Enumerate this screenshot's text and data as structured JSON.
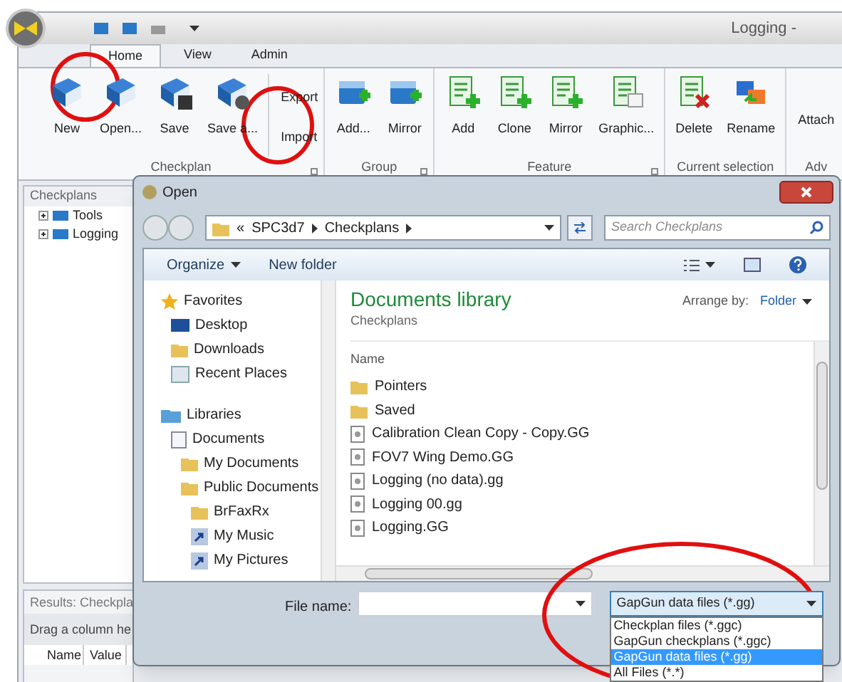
{
  "window": {
    "title": "Logging -"
  },
  "ribbon_tabs": [
    {
      "label": "Home",
      "selected": true
    },
    {
      "label": "View",
      "selected": false
    },
    {
      "label": "Admin",
      "selected": false
    }
  ],
  "ribbon_groups": [
    {
      "title": "Checkplan",
      "launcher": true,
      "buttons": [
        {
          "label": "New",
          "kind": "large"
        },
        {
          "label": "Open...",
          "kind": "large"
        },
        {
          "label": "Save",
          "kind": "large"
        },
        {
          "label": "Save a...",
          "kind": "large"
        },
        {
          "label": "Export",
          "kind": "small"
        },
        {
          "label": "Import",
          "kind": "small"
        }
      ]
    },
    {
      "title": "Group",
      "launcher": true,
      "buttons": [
        {
          "label": "Add...",
          "kind": "large"
        },
        {
          "label": "Mirror",
          "kind": "large"
        }
      ]
    },
    {
      "title": "Feature",
      "launcher": true,
      "buttons": [
        {
          "label": "Add",
          "kind": "large"
        },
        {
          "label": "Clone",
          "kind": "large"
        },
        {
          "label": "Mirror",
          "kind": "large"
        },
        {
          "label": "Graphic...",
          "kind": "large"
        }
      ]
    },
    {
      "title": "Current selection",
      "launcher": false,
      "buttons": [
        {
          "label": "Delete",
          "kind": "large"
        },
        {
          "label": "Rename",
          "kind": "large"
        }
      ]
    },
    {
      "title": "Adv",
      "launcher": false,
      "buttons": [
        {
          "label": "Attach",
          "kind": "text"
        }
      ]
    }
  ],
  "checkplans_pane": {
    "title": "Checkplans",
    "tree": [
      {
        "label": "Tools",
        "expanded": false
      },
      {
        "label": "Logging",
        "expanded": false
      }
    ]
  },
  "results_pane": {
    "title": "Results: Checkpla",
    "hint": "Drag a column he",
    "columns": [
      "Name",
      "Value"
    ]
  },
  "dialog": {
    "title": "Open",
    "breadcrumb": {
      "prefix": "«",
      "parts": [
        "SPC3d7",
        "Checkplans"
      ]
    },
    "search": {
      "placeholder": "Search Checkplans"
    },
    "toolbar": [
      "Organize",
      "New folder"
    ],
    "nav": [
      {
        "label": "Favorites",
        "kind": "star",
        "children": [
          {
            "label": "Desktop",
            "kind": "desktop"
          },
          {
            "label": "Downloads",
            "kind": "download"
          },
          {
            "label": "Recent Places",
            "kind": "recent"
          }
        ]
      },
      {
        "label": "Libraries",
        "kind": "library",
        "children": [
          {
            "label": "Documents",
            "kind": "document",
            "children": [
              {
                "label": "My Documents",
                "kind": "folder"
              },
              {
                "label": "Public Documents",
                "kind": "folder",
                "children": [
                  {
                    "label": "BrFaxRx",
                    "kind": "folder"
                  },
                  {
                    "label": "My Music",
                    "kind": "shortcut"
                  },
                  {
                    "label": "My Pictures",
                    "kind": "shortcut"
                  }
                ]
              }
            ]
          }
        ]
      }
    ],
    "library": {
      "title": "Documents library",
      "subtitle": "Checkplans",
      "arrange_label": "Arrange by:",
      "arrange_value": "Folder"
    },
    "column": "Name",
    "files": [
      {
        "name": "Pointers",
        "kind": "folder"
      },
      {
        "name": "Saved",
        "kind": "folder"
      },
      {
        "name": "Calibration Clean Copy - Copy.GG",
        "kind": "file"
      },
      {
        "name": "FOV7 Wing Demo.GG",
        "kind": "file"
      },
      {
        "name": "Logging (no data).gg",
        "kind": "file"
      },
      {
        "name": "Logging 00.gg",
        "kind": "file"
      },
      {
        "name": "Logging.GG",
        "kind": "file"
      }
    ],
    "file_name_label": "File name:",
    "filter": {
      "value": "GapGun data files (*.gg)",
      "expanded": true,
      "options": [
        {
          "label": "Checkplan files (*.ggc)",
          "selected": false
        },
        {
          "label": "GapGun checkplans (*.ggc)",
          "selected": false
        },
        {
          "label": "GapGun data files (*.gg)",
          "selected": true
        },
        {
          "label": "All Files (*.*)",
          "selected": false
        }
      ]
    }
  }
}
